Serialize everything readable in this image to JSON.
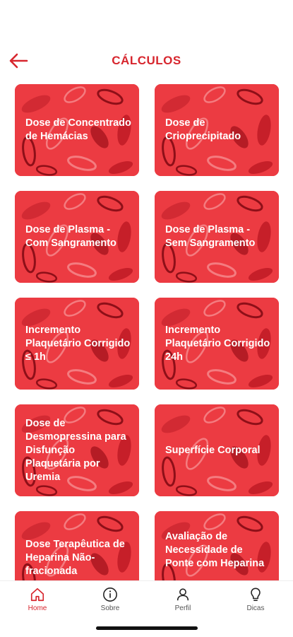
{
  "header": {
    "title": "CÁLCULOS"
  },
  "colors": {
    "accent": "#D7262E",
    "card": "#EC3B42"
  },
  "cards": [
    {
      "label": "Dose de Concentrado de Hemácias"
    },
    {
      "label": "Dose de Crioprecipitado"
    },
    {
      "label": "Dose de Plasma - Com Sangramento"
    },
    {
      "label": "Dose de Plasma - Sem Sangramento"
    },
    {
      "label": "Incremento Plaquetário Corrigido ≤ 1h"
    },
    {
      "label": "Incremento Plaquetário Corrigido 24h"
    },
    {
      "label": "Dose de Desmopressina para Disfunção Plaquetária por Uremia"
    },
    {
      "label": "Superfície Corporal"
    },
    {
      "label": "Dose Terapêutica de Heparina Não-fracionada"
    },
    {
      "label": "Avaliação de Necessidade de Ponte com Heparina"
    }
  ],
  "nav": {
    "home": {
      "label": "Home",
      "icon": "home-icon"
    },
    "about": {
      "label": "Sobre",
      "icon": "info-icon"
    },
    "profile": {
      "label": "Perfil",
      "icon": "user-icon"
    },
    "tips": {
      "label": "Dicas",
      "icon": "lightbulb-icon"
    }
  }
}
